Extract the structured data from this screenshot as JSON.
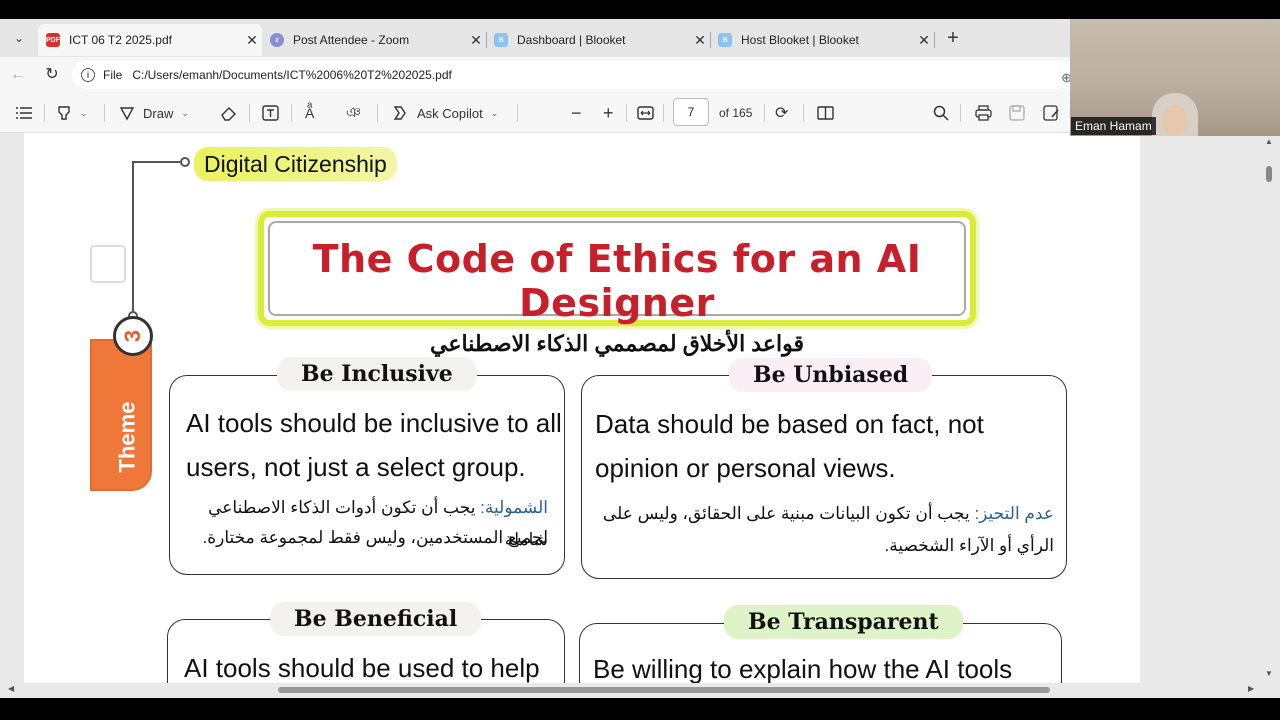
{
  "tabs": [
    {
      "label": "ICT 06 T2 2025.pdf",
      "icon": "pdf-icon",
      "active": true,
      "icon_color": "#d9302b"
    },
    {
      "label": "Post Attendee - Zoom",
      "icon": "zoom-icon",
      "active": false,
      "icon_color": "#8a8cd8"
    },
    {
      "label": "Dashboard | Blooket",
      "icon": "blooket-icon",
      "active": false,
      "icon_color": "#8bc3f1"
    },
    {
      "label": "Host Blooket | Blooket",
      "icon": "blooket-icon",
      "active": false,
      "icon_color": "#8bc3f1"
    }
  ],
  "address": {
    "scheme": "File",
    "url": "C:/Users/emanh/Documents/ICT%2006%20T2%202025.pdf"
  },
  "toolbar": {
    "draw_label": "Draw",
    "copilot_label": "Ask Copilot",
    "page_number": "7",
    "page_total": "of 165"
  },
  "page": {
    "section_label": "Digital Citizenship",
    "theme_label": "Theme",
    "theme_number": "3",
    "title_en": "The Code of Ethics for an AI Designer",
    "title_ar": "قواعد الأخلاق لمصممي الذكاء الاصطناعي",
    "cards": [
      {
        "heading": "Be Inclusive",
        "en_line1": "AI tools should be inclusive to all",
        "en_line2": "users, not just a select group.",
        "ar_keyword": "الشمولية:",
        "ar_line1": "يجب أن تكون أدوات الذكاء الاصطناعي شاملة",
        "ar_line2": "لجميع المستخدمين، وليس فقط لمجموعة مختارة."
      },
      {
        "heading": "Be Unbiased",
        "en_line1": "Data should be based on fact, not",
        "en_line2": "opinion or personal views.",
        "ar_keyword": "عدم التحيز:",
        "ar_line1": "يجب أن تكون البيانات مبنية على الحقائق، وليس على",
        "ar_line2": "الرأي أو الآراء الشخصية."
      },
      {
        "heading": "Be Beneficial",
        "en_line1": "AI tools should be used to help"
      },
      {
        "heading": "Be Transparent",
        "en_line1": "Be willing to explain how the AI tools"
      }
    ]
  },
  "video": {
    "participant_name": "Eman Hamam"
  }
}
